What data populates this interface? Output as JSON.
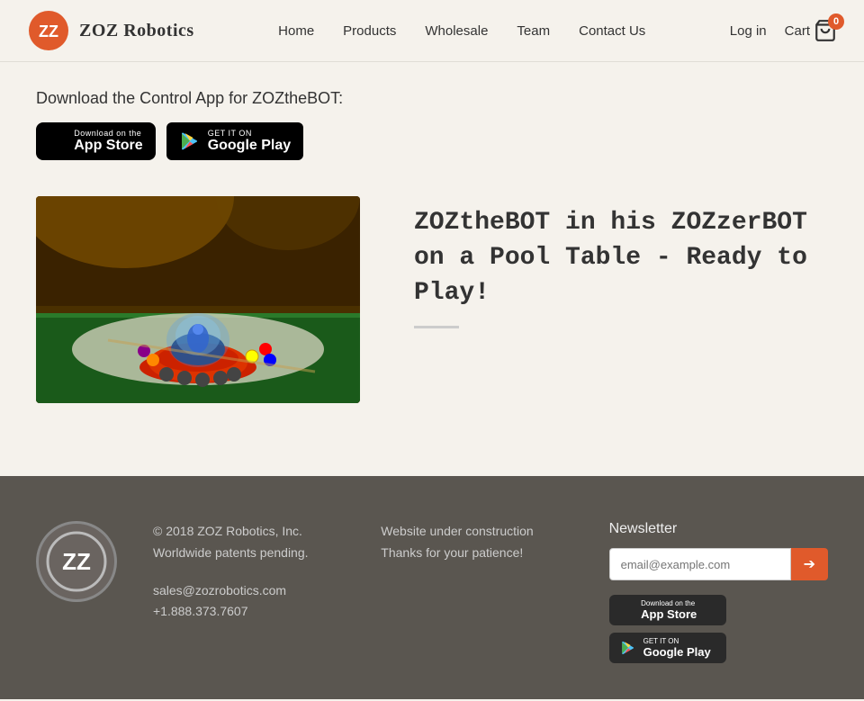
{
  "header": {
    "logo_text": "ZOZ Robotics",
    "nav_items": [
      {
        "label": "Home",
        "href": "#"
      },
      {
        "label": "Products",
        "href": "#"
      },
      {
        "label": "Wholesale",
        "href": "#"
      },
      {
        "label": "Team",
        "href": "#"
      },
      {
        "label": "Contact Us",
        "href": "#"
      }
    ],
    "login_label": "Log in",
    "cart_label": "Cart",
    "cart_count": "0"
  },
  "main": {
    "download_text": "Download the Control App for ZOZtheBOT:",
    "app_store": {
      "sub_label": "Download on the",
      "main_label": "App Store"
    },
    "google_play": {
      "sub_label": "GET IT ON",
      "main_label": "Google Play"
    },
    "product_title": "ZOZtheBOT in his ZOZzerBOT on a Pool Table - Ready to Play!"
  },
  "footer": {
    "copyright": "© 2018 ZOZ Robotics, Inc.",
    "patents": "Worldwide patents pending.",
    "website_status": "Website under construction",
    "patience_text": "Thanks for your patience!",
    "email": "sales@zozrobotics.com",
    "phone": "+1.888.373.7607",
    "newsletter_title": "Newsletter",
    "newsletter_placeholder": "email@example.com",
    "app_store_sub": "Download on the",
    "app_store_main": "App Store",
    "google_play_sub": "GET IT ON",
    "google_play_main": "Google Play"
  }
}
